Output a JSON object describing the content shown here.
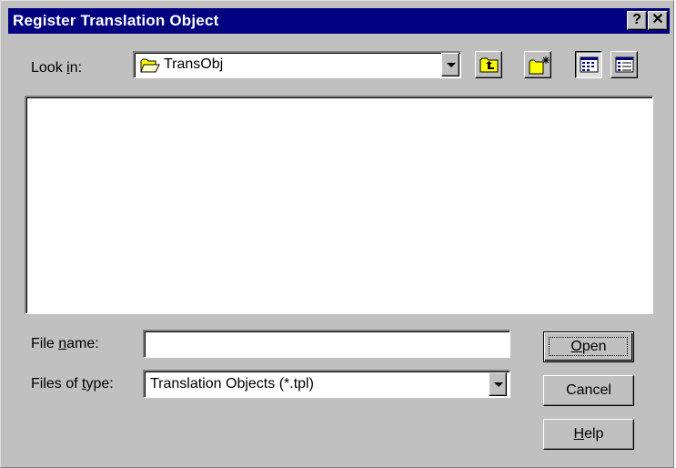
{
  "window": {
    "title": "Register Translation Object",
    "help_glyph": "?",
    "close_glyph": "✕"
  },
  "look_in": {
    "label_pre": "Look ",
    "label_mn": "i",
    "label_post": "n:",
    "value": "TransObj",
    "icon": "folder-icon"
  },
  "toolbar": {
    "buttons": [
      {
        "name": "up-one-level-button",
        "icon": "folder-up-icon"
      },
      {
        "name": "create-new-folder-button",
        "icon": "new-folder-icon"
      },
      {
        "name": "list-view-button",
        "icon": "list-view-icon",
        "pressed": true
      },
      {
        "name": "details-view-button",
        "icon": "details-view-icon",
        "pressed": false
      }
    ]
  },
  "file_name": {
    "label_pre": "File ",
    "label_mn": "n",
    "label_post": "ame:",
    "value": ""
  },
  "file_type": {
    "label_pre": "Files of ",
    "label_mn": "t",
    "label_post": "ype:",
    "value": "Translation Objects (*.tpl)"
  },
  "buttons": {
    "open_mn": "O",
    "open_rest": "pen",
    "cancel": "Cancel",
    "help_mn": "H",
    "help_rest": "elp"
  },
  "colors": {
    "title_bar": "#000080",
    "face": "#c0c0c0",
    "folder_yellow": "#ffff00"
  }
}
